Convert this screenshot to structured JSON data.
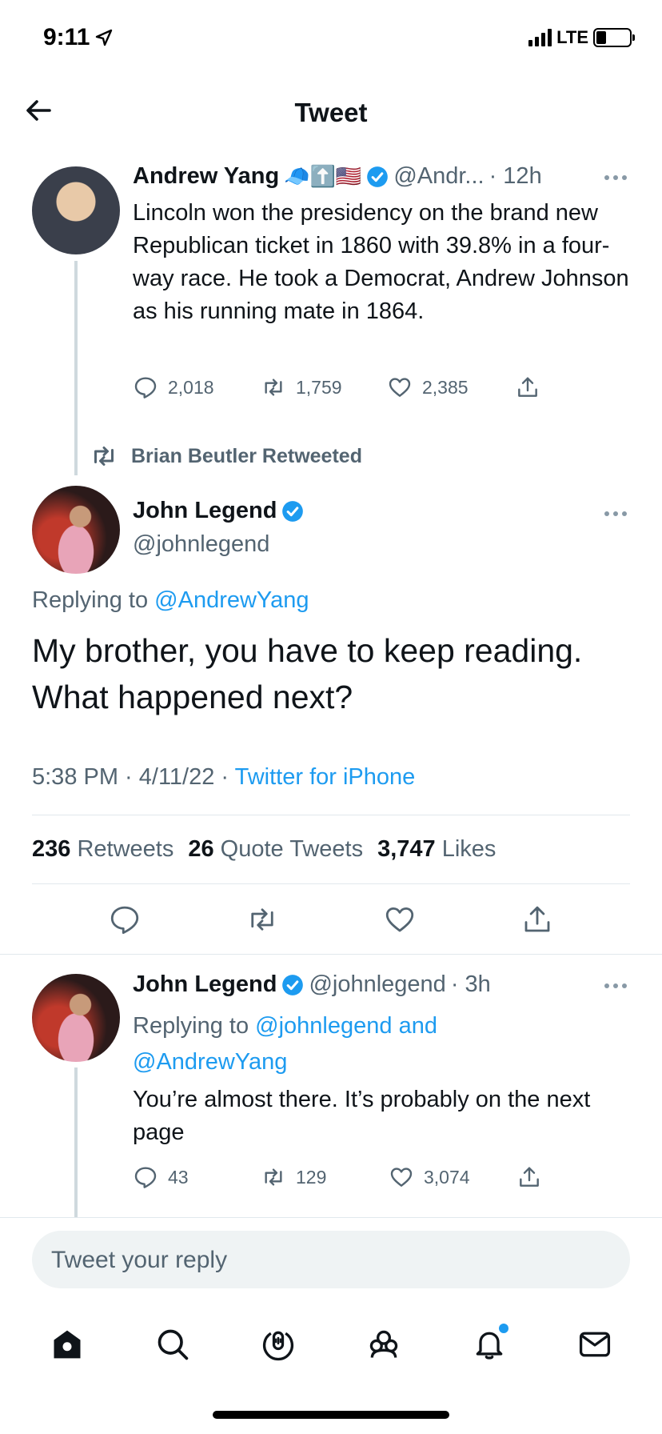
{
  "status_bar": {
    "time": "9:11",
    "network": "LTE"
  },
  "header": {
    "title": "Tweet"
  },
  "parent_tweet": {
    "name": "Andrew Yang",
    "emojis": "🧢⬆️🇺🇸",
    "handle": "@Andr...",
    "time": "· 12h",
    "text": "Lincoln won the presidency on the brand new Republican ticket in 1860 with 39.8% in a four-way race. He took a Democrat, Andrew Johnson as his running mate in 1864.",
    "replies": "2,018",
    "retweets": "1,759",
    "likes": "2,385"
  },
  "retweet_context": {
    "label": "Brian Beutler Retweeted"
  },
  "main_tweet": {
    "name": "John Legend",
    "handle": "@johnlegend",
    "replying_prefix": "Replying to ",
    "replying_to": "@AndrewYang",
    "text": "My brother, you have to keep reading. What happened next?",
    "timestamp": "5:38 PM · 4/11/22 · ",
    "source": "Twitter for iPhone",
    "retweets_count": "236",
    "retweets_label": "Retweets",
    "quotes_count": "26",
    "quotes_label": "Quote Tweets",
    "likes_count": "3,747",
    "likes_label": "Likes"
  },
  "reply_tweet": {
    "name": "John Legend",
    "handle": "@johnlegend",
    "time": "· 3h",
    "replying_prefix": "Replying to ",
    "replying_to_1": "@johnlegend and",
    "replying_to_2": "@AndrewYang",
    "text": "You’re almost there. It’s probably on the next page",
    "replies": "43",
    "retweets": "129",
    "likes": "3,074"
  },
  "composer": {
    "placeholder": "Tweet your reply"
  },
  "colors": {
    "accent": "#1d9bf0",
    "muted": "#536471",
    "divider": "#e1e8ed"
  },
  "tabbar_icons": [
    "home-icon",
    "search-icon",
    "spaces-icon",
    "communities-icon",
    "notifications-icon",
    "messages-icon"
  ]
}
